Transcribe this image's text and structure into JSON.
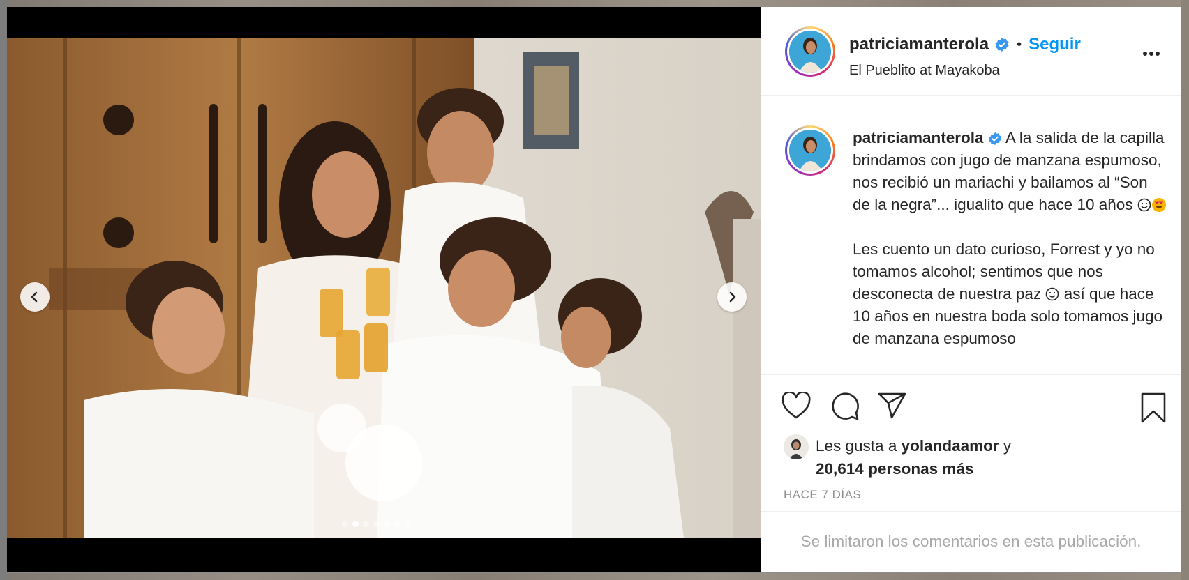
{
  "post": {
    "username": "patriciamanterola",
    "follow_label": "Seguir",
    "separator": "•",
    "location": "El Pueblito at Mayakoba",
    "caption_p1": "A la salida de la capilla brindamos con jugo de manzana espumoso, nos recibió un mariachi y bailamos al “Son de la negra”... igualito que hace 10 años",
    "caption_p2a": "Les cuento un dato curioso, Forrest y yo no tomamos alcohol; sentimos que nos desconecta de nuestra paz",
    "caption_p2b": "así que hace 10 años en nuestra boda solo tomamos jugo de manzana espumoso",
    "likes_prefix": "Les gusta a",
    "liker": "yolandaamor",
    "likes_join": "y",
    "likes_count_text": "20,614 personas más",
    "time_ago": "HACE 7 DÍAS",
    "comments_notice": "Se limitaron los comentarios en esta publicación."
  },
  "carousel": {
    "slide_count": 7,
    "active_index": 1
  },
  "icons": [
    "chevron-left-icon",
    "chevron-right-icon",
    "verified-badge-icon",
    "more-icon",
    "heart-icon",
    "comment-icon",
    "share-icon",
    "bookmark-icon"
  ],
  "colors": {
    "accent": "#0095f6",
    "text": "#262626",
    "muted": "#8e8e8e"
  }
}
